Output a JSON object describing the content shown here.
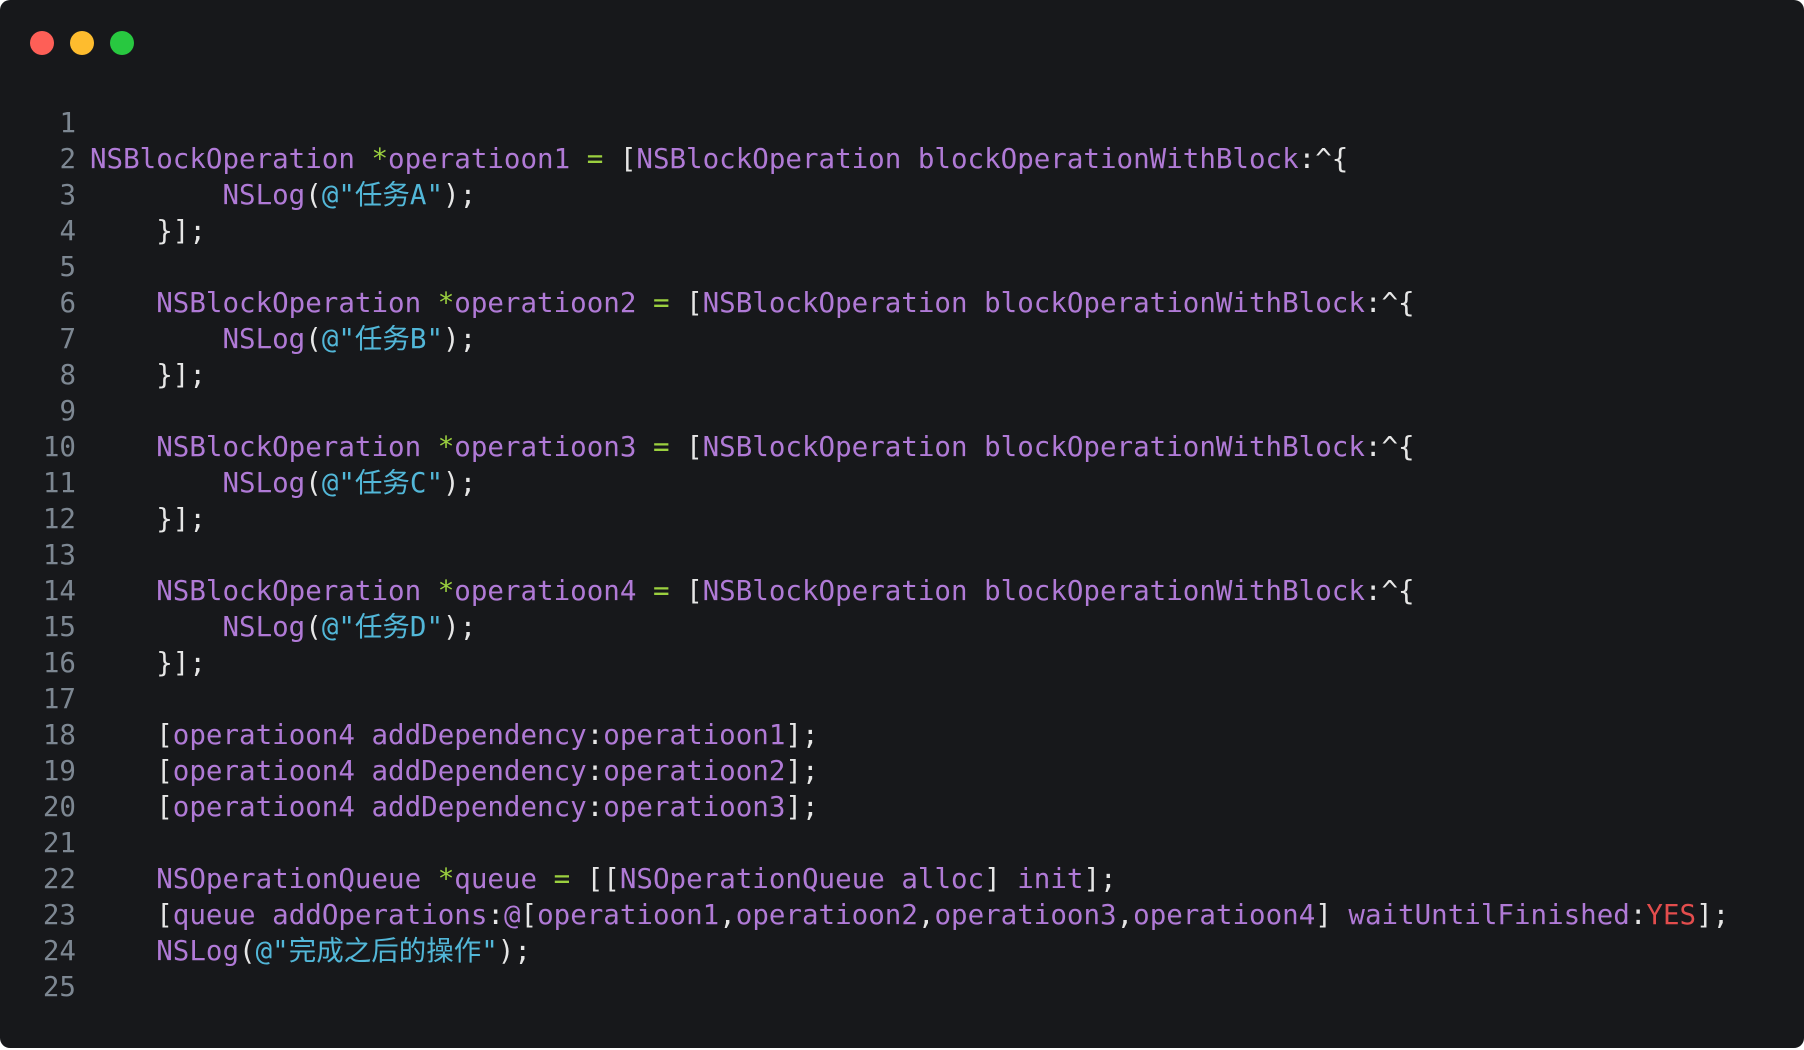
{
  "window": {
    "buttons": {
      "close": "close",
      "minimize": "minimize",
      "maximize": "maximize"
    }
  },
  "colors": {
    "background": "#17181b",
    "line_number": "#7d8792",
    "default": "#e6e6e6",
    "class": "#b07ad6",
    "variable": "#b07ad6",
    "method": "#b07ad6",
    "string": "#52b7d8",
    "keyword": "#e34d4d",
    "operator": "#9bd03f"
  },
  "code": {
    "language": "Objective-C",
    "lines": [
      {
        "number": "1",
        "tokens": []
      },
      {
        "number": "2",
        "tokens": [
          {
            "t": "NSBlockOperation",
            "c": "class"
          },
          {
            "t": " ",
            "c": "default"
          },
          {
            "t": "*",
            "c": "operator"
          },
          {
            "t": "operatioon1",
            "c": "variable"
          },
          {
            "t": " = ",
            "c": "operator"
          },
          {
            "t": "[",
            "c": "default"
          },
          {
            "t": "NSBlockOperation",
            "c": "class"
          },
          {
            "t": " ",
            "c": "default"
          },
          {
            "t": "blockOperationWithBlock",
            "c": "method"
          },
          {
            "t": ":^{",
            "c": "default"
          }
        ]
      },
      {
        "number": "3",
        "tokens": [
          {
            "t": "        ",
            "c": "default"
          },
          {
            "t": "NSLog",
            "c": "method"
          },
          {
            "t": "(",
            "c": "default"
          },
          {
            "t": "@\"任务A\"",
            "c": "string"
          },
          {
            "t": ");",
            "c": "default"
          }
        ]
      },
      {
        "number": "4",
        "tokens": [
          {
            "t": "    }];",
            "c": "default"
          }
        ]
      },
      {
        "number": "5",
        "tokens": []
      },
      {
        "number": "6",
        "tokens": [
          {
            "t": "    ",
            "c": "default"
          },
          {
            "t": "NSBlockOperation",
            "c": "class"
          },
          {
            "t": " ",
            "c": "default"
          },
          {
            "t": "*",
            "c": "operator"
          },
          {
            "t": "operatioon2",
            "c": "variable"
          },
          {
            "t": " = ",
            "c": "operator"
          },
          {
            "t": "[",
            "c": "default"
          },
          {
            "t": "NSBlockOperation",
            "c": "class"
          },
          {
            "t": " ",
            "c": "default"
          },
          {
            "t": "blockOperationWithBlock",
            "c": "method"
          },
          {
            "t": ":^{",
            "c": "default"
          }
        ]
      },
      {
        "number": "7",
        "tokens": [
          {
            "t": "        ",
            "c": "default"
          },
          {
            "t": "NSLog",
            "c": "method"
          },
          {
            "t": "(",
            "c": "default"
          },
          {
            "t": "@\"任务B\"",
            "c": "string"
          },
          {
            "t": ");",
            "c": "default"
          }
        ]
      },
      {
        "number": "8",
        "tokens": [
          {
            "t": "    }];",
            "c": "default"
          }
        ]
      },
      {
        "number": "9",
        "tokens": []
      },
      {
        "number": "10",
        "tokens": [
          {
            "t": "    ",
            "c": "default"
          },
          {
            "t": "NSBlockOperation",
            "c": "class"
          },
          {
            "t": " ",
            "c": "default"
          },
          {
            "t": "*",
            "c": "operator"
          },
          {
            "t": "operatioon3",
            "c": "variable"
          },
          {
            "t": " = ",
            "c": "operator"
          },
          {
            "t": "[",
            "c": "default"
          },
          {
            "t": "NSBlockOperation",
            "c": "class"
          },
          {
            "t": " ",
            "c": "default"
          },
          {
            "t": "blockOperationWithBlock",
            "c": "method"
          },
          {
            "t": ":^{",
            "c": "default"
          }
        ]
      },
      {
        "number": "11",
        "tokens": [
          {
            "t": "        ",
            "c": "default"
          },
          {
            "t": "NSLog",
            "c": "method"
          },
          {
            "t": "(",
            "c": "default"
          },
          {
            "t": "@\"任务C\"",
            "c": "string"
          },
          {
            "t": ");",
            "c": "default"
          }
        ]
      },
      {
        "number": "12",
        "tokens": [
          {
            "t": "    }];",
            "c": "default"
          }
        ]
      },
      {
        "number": "13",
        "tokens": []
      },
      {
        "number": "14",
        "tokens": [
          {
            "t": "    ",
            "c": "default"
          },
          {
            "t": "NSBlockOperation",
            "c": "class"
          },
          {
            "t": " ",
            "c": "default"
          },
          {
            "t": "*",
            "c": "operator"
          },
          {
            "t": "operatioon4",
            "c": "variable"
          },
          {
            "t": " = ",
            "c": "operator"
          },
          {
            "t": "[",
            "c": "default"
          },
          {
            "t": "NSBlockOperation",
            "c": "class"
          },
          {
            "t": " ",
            "c": "default"
          },
          {
            "t": "blockOperationWithBlock",
            "c": "method"
          },
          {
            "t": ":^{",
            "c": "default"
          }
        ]
      },
      {
        "number": "15",
        "tokens": [
          {
            "t": "        ",
            "c": "default"
          },
          {
            "t": "NSLog",
            "c": "method"
          },
          {
            "t": "(",
            "c": "default"
          },
          {
            "t": "@\"任务D\"",
            "c": "string"
          },
          {
            "t": ");",
            "c": "default"
          }
        ]
      },
      {
        "number": "16",
        "tokens": [
          {
            "t": "    }];",
            "c": "default"
          }
        ]
      },
      {
        "number": "17",
        "tokens": []
      },
      {
        "number": "18",
        "tokens": [
          {
            "t": "    [",
            "c": "default"
          },
          {
            "t": "operatioon4",
            "c": "variable"
          },
          {
            "t": " ",
            "c": "default"
          },
          {
            "t": "addDependency",
            "c": "method"
          },
          {
            "t": ":",
            "c": "default"
          },
          {
            "t": "operatioon1",
            "c": "variable"
          },
          {
            "t": "];",
            "c": "default"
          }
        ]
      },
      {
        "number": "19",
        "tokens": [
          {
            "t": "    [",
            "c": "default"
          },
          {
            "t": "operatioon4",
            "c": "variable"
          },
          {
            "t": " ",
            "c": "default"
          },
          {
            "t": "addDependency",
            "c": "method"
          },
          {
            "t": ":",
            "c": "default"
          },
          {
            "t": "operatioon2",
            "c": "variable"
          },
          {
            "t": "];",
            "c": "default"
          }
        ]
      },
      {
        "number": "20",
        "tokens": [
          {
            "t": "    [",
            "c": "default"
          },
          {
            "t": "operatioon4",
            "c": "variable"
          },
          {
            "t": " ",
            "c": "default"
          },
          {
            "t": "addDependency",
            "c": "method"
          },
          {
            "t": ":",
            "c": "default"
          },
          {
            "t": "operatioon3",
            "c": "variable"
          },
          {
            "t": "];",
            "c": "default"
          }
        ]
      },
      {
        "number": "21",
        "tokens": []
      },
      {
        "number": "22",
        "tokens": [
          {
            "t": "    ",
            "c": "default"
          },
          {
            "t": "NSOperationQueue",
            "c": "class"
          },
          {
            "t": " ",
            "c": "default"
          },
          {
            "t": "*",
            "c": "operator"
          },
          {
            "t": "queue",
            "c": "variable"
          },
          {
            "t": " = ",
            "c": "operator"
          },
          {
            "t": "[[",
            "c": "default"
          },
          {
            "t": "NSOperationQueue",
            "c": "class"
          },
          {
            "t": " ",
            "c": "default"
          },
          {
            "t": "alloc",
            "c": "method"
          },
          {
            "t": "] ",
            "c": "default"
          },
          {
            "t": "init",
            "c": "method"
          },
          {
            "t": "];",
            "c": "default"
          }
        ]
      },
      {
        "number": "23",
        "tokens": [
          {
            "t": "    [",
            "c": "default"
          },
          {
            "t": "queue",
            "c": "variable"
          },
          {
            "t": " ",
            "c": "default"
          },
          {
            "t": "addOperations",
            "c": "method"
          },
          {
            "t": ":",
            "c": "default"
          },
          {
            "t": "@",
            "c": "variable"
          },
          {
            "t": "[",
            "c": "default"
          },
          {
            "t": "operatioon1",
            "c": "variable"
          },
          {
            "t": ",",
            "c": "default"
          },
          {
            "t": "operatioon2",
            "c": "variable"
          },
          {
            "t": ",",
            "c": "default"
          },
          {
            "t": "operatioon3",
            "c": "variable"
          },
          {
            "t": ",",
            "c": "default"
          },
          {
            "t": "operatioon4",
            "c": "variable"
          },
          {
            "t": "] ",
            "c": "default"
          },
          {
            "t": "waitUntilFinished",
            "c": "method"
          },
          {
            "t": ":",
            "c": "default"
          },
          {
            "t": "YES",
            "c": "keyword"
          },
          {
            "t": "];",
            "c": "default"
          }
        ]
      },
      {
        "number": "24",
        "tokens": [
          {
            "t": "    ",
            "c": "default"
          },
          {
            "t": "NSLog",
            "c": "method"
          },
          {
            "t": "(",
            "c": "default"
          },
          {
            "t": "@\"完成之后的操作\"",
            "c": "string"
          },
          {
            "t": ");",
            "c": "default"
          }
        ]
      },
      {
        "number": "25",
        "tokens": []
      }
    ]
  }
}
